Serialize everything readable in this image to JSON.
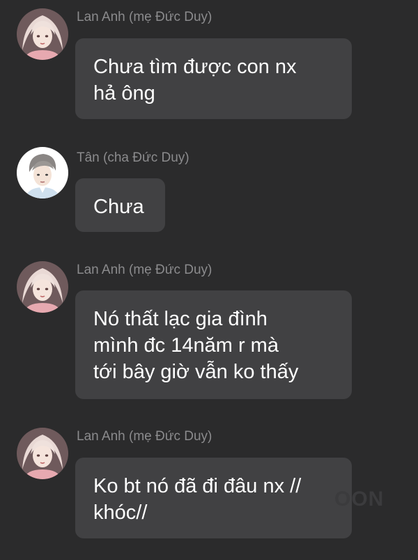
{
  "messages": [
    {
      "sender": "Lan Anh (mẹ Đức Duy)",
      "avatar": "woman-avatar",
      "lines": [
        "Chưa tìm được con nx",
        "hả ông"
      ]
    },
    {
      "sender": "Tân (cha Đức Duy)",
      "avatar": "man-avatar",
      "lines": [
        "Chưa"
      ]
    },
    {
      "sender": "Lan Anh (mẹ Đức Duy)",
      "avatar": "woman-avatar",
      "lines": [
        "Nó thất lạc gia đình",
        "mình đc 14năm r mà",
        "tới bây giờ vẫn ko thấy"
      ]
    },
    {
      "sender": "Lan Anh (mẹ Đức Duy)",
      "avatar": "woman-avatar",
      "lines": [
        "Ko bt nó đã đi đâu nx //",
        "khóc//"
      ]
    }
  ],
  "watermark": "OON",
  "colors": {
    "background": "#2b2b2c",
    "bubble": "#414143",
    "sender_text": "#8b8b8d",
    "message_text": "#ffffff"
  }
}
